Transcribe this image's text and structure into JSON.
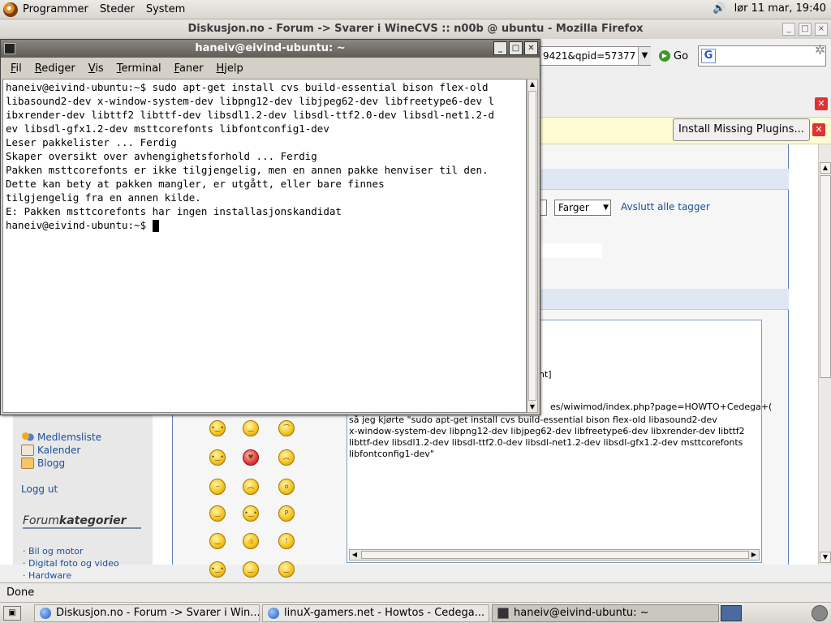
{
  "top_panel": {
    "menus": [
      "Programmer",
      "Steder",
      "System"
    ],
    "clock": "lør 11 mar, 19:40",
    "volume_icon": "speaker-icon"
  },
  "firefox": {
    "title": "Diskusjon.no - Forum -> Svarer i WineCVS :: n00b @ ubuntu - Mozilla Firefox",
    "url_visible": "9421&qpid=57377",
    "go_label": "Go",
    "search_icon": "google-icon",
    "plugin_button": "Install Missing Plugins...",
    "status": "Done",
    "colors_select": "Farger",
    "close_tags_link": "Avslutt alle tagger",
    "editor": {
      "fragment_1": "nt]",
      "fragment_2": "es/wiwimod/index.php?page=HOWTO+Cedega+(",
      "text": "så jeg kjørte \"sudo apt-get install cvs build-essential bison flex-old libasound2-dev\nx-window-system-dev libpng12-dev libjpeg62-dev libfreetype6-dev libxrender-dev libttf2\nlibttf-dev libsdl1.2-dev libsdl-ttf2.0-dev libsdl-net1.2-dev libsdl-gfx1.2-dev msttcorefonts\nlibfontconfig1-dev\""
    },
    "sidebar": {
      "links": [
        {
          "label": "Medlemsliste",
          "icon": "members-icon"
        },
        {
          "label": "Kalender",
          "icon": "calendar-icon"
        },
        {
          "label": "Blogg",
          "icon": "envelope-icon"
        }
      ],
      "logout": "Logg ut",
      "categories_title_a": "Forum",
      "categories_title_b": "kategorier",
      "categories": [
        "· Bil og motor",
        "· Digital foto og video",
        "· Hardware"
      ]
    }
  },
  "terminal": {
    "title": "haneiv@eivind-ubuntu: ~",
    "menus": [
      "Fil",
      "Rediger",
      "Vis",
      "Terminal",
      "Faner",
      "Hjelp"
    ],
    "lines": [
      "haneiv@eivind-ubuntu:~$ sudo apt-get install cvs build-essential bison flex-old",
      "libasound2-dev x-window-system-dev libpng12-dev libjpeg62-dev libfreetype6-dev l",
      "ibxrender-dev libttf2 libttf-dev libsdl1.2-dev libsdl-ttf2.0-dev libsdl-net1.2-d",
      "ev libsdl-gfx1.2-dev msttcorefonts libfontconfig1-dev",
      "Leser pakkelister ... Ferdig",
      "Skaper oversikt over avhengighetsforhold ... Ferdig",
      "Pakken msttcorefonts er ikke tilgjengelig, men en annen pakke henviser til den.",
      "Dette kan bety at pakken mangler, er utgått, eller bare finnes",
      "tilgjengelig fra en annen kilde.",
      "E: Pakken msttcorefonts har ingen installasjonskandidat"
    ],
    "prompt": "haneiv@eivind-ubuntu:~$ "
  },
  "taskbar": {
    "tasks": [
      {
        "label": "Diskusjon.no - Forum -> Svarer i Win...",
        "icon": "firefox-icon"
      },
      {
        "label": "linuX-gamers.net - Howtos - Cedega...",
        "icon": "firefox-icon"
      },
      {
        "label": "haneiv@eivind-ubuntu: ~",
        "icon": "terminal-icon"
      }
    ]
  },
  "colors": {
    "forum_blue": "#5c7fb4",
    "link_blue": "#1a4e9a",
    "plugin_bar": "#fffbd2",
    "close_red": "#dd3333"
  }
}
